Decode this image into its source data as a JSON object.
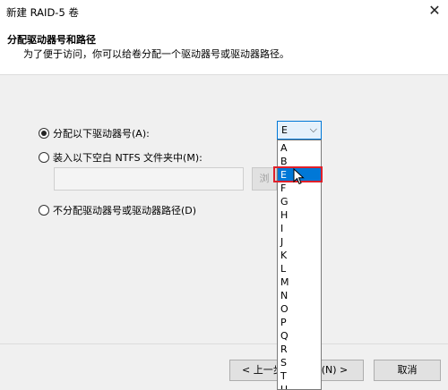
{
  "window": {
    "title": "新建 RAID-5 卷"
  },
  "header": {
    "title": "分配驱动器号和路径",
    "description": "为了便于访问，你可以给卷分配一个驱动器号或驱动器路径。"
  },
  "options": {
    "assign_letter": "分配以下驱动器号(A):",
    "mount_folder": "装入以下空白 NTFS 文件夹中(M):",
    "no_assign": "不分配驱动器号或驱动器路径(D)"
  },
  "drive_combo": {
    "value": "E"
  },
  "browse_button": {
    "label": "浏"
  },
  "dropdown": {
    "items": [
      "A",
      "B",
      "E",
      "F",
      "G",
      "H",
      "I",
      "J",
      "K",
      "L",
      "M",
      "N",
      "O",
      "P",
      "Q",
      "R",
      "S",
      "T",
      "U"
    ],
    "selected": "E"
  },
  "footer": {
    "back_label": "< 上一步(",
    "next_label": "步(N) >",
    "cancel_label": "取消"
  },
  "colors": {
    "accent": "#0078d7",
    "highlight_box": "#e0202a"
  }
}
